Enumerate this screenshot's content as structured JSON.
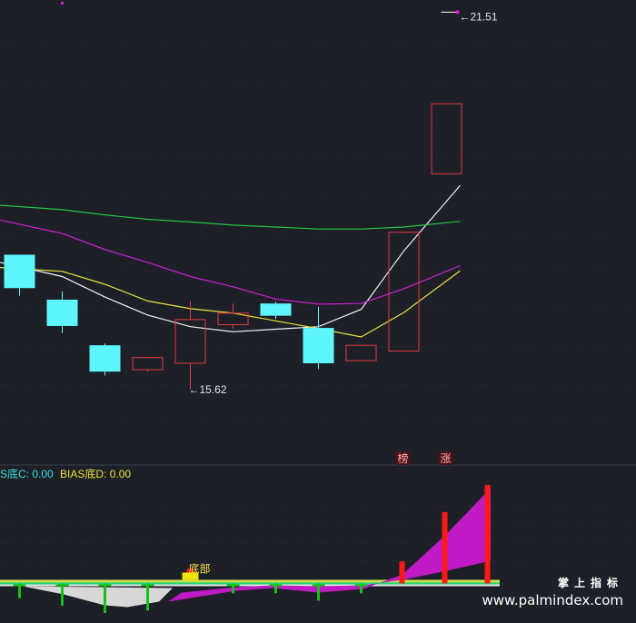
{
  "colors": {
    "bg": "#1c1f26",
    "grid": "#2a2f38",
    "up": "#e23b3b",
    "down": "#5ff7ff",
    "ma_white": "#f2f2f2",
    "ma_yellow": "#e8e23a",
    "ma_magenta": "#d21fd6",
    "ma_green": "#22c845",
    "bias_c": "#39e0e0",
    "bias_d": "#e8e23a",
    "fill_magenta": "#c01ac4",
    "bar_red": "#ff1a1a",
    "bar_green": "#14c214",
    "fill_gray": "#d8d8d8"
  },
  "chart_data": {
    "type": "candlestick",
    "price_axis": {
      "min": 14.8,
      "max": 21.6
    },
    "candles": [
      {
        "o": 17.72,
        "h": 17.72,
        "l": 17.08,
        "c": 17.2
      },
      {
        "o": 17.02,
        "h": 17.15,
        "l": 16.5,
        "c": 16.61
      },
      {
        "o": 16.31,
        "h": 16.34,
        "l": 15.84,
        "c": 15.9
      },
      {
        "o": 15.93,
        "h": 16.12,
        "l": 15.9,
        "c": 16.12
      },
      {
        "o": 16.03,
        "h": 17.0,
        "l": 15.62,
        "c": 16.71
      },
      {
        "o": 16.63,
        "h": 16.96,
        "l": 16.57,
        "c": 16.81
      },
      {
        "o": 16.96,
        "h": 16.99,
        "l": 16.72,
        "c": 16.77
      },
      {
        "o": 16.58,
        "h": 16.91,
        "l": 15.94,
        "c": 16.03
      },
      {
        "o": 16.07,
        "h": 16.31,
        "l": 16.07,
        "c": 16.31
      },
      {
        "o": 16.22,
        "h": 18.07,
        "l": 16.22,
        "c": 18.07
      },
      {
        "o": 18.98,
        "h": 20.07,
        "l": 18.98,
        "c": 20.07
      }
    ],
    "ma_lines": [
      {
        "color_key": "ma_white",
        "values": [
          17.6,
          17.38,
          17.06,
          16.78,
          16.6,
          16.52,
          16.56,
          16.6,
          16.87,
          17.78,
          18.8
        ]
      },
      {
        "color_key": "ma_yellow",
        "values": [
          17.52,
          17.46,
          17.26,
          17.0,
          16.88,
          16.81,
          16.69,
          16.57,
          16.44,
          16.82,
          17.47
        ]
      },
      {
        "color_key": "ma_magenta",
        "values": [
          18.26,
          18.05,
          17.8,
          17.6,
          17.38,
          17.22,
          17.03,
          16.95,
          16.96,
          17.19,
          17.55
        ]
      },
      {
        "color_key": "ma_green",
        "values": [
          18.49,
          18.42,
          18.34,
          18.27,
          18.23,
          18.18,
          18.15,
          18.12,
          18.12,
          18.15,
          18.24
        ]
      }
    ],
    "annotations": [
      {
        "label": "15.62",
        "candle": 4,
        "price": 15.62,
        "kind": "low"
      },
      {
        "label": "21.51",
        "candle": 10,
        "price": 21.51,
        "kind": "high"
      }
    ],
    "tags": [
      {
        "label": "榜",
        "candle": 9
      },
      {
        "label": "涨",
        "candle": 10
      }
    ],
    "indicator": {
      "legend": [
        {
          "label": "S底C: 0.00",
          "color_key": "bias_c"
        },
        {
          "label": "BIAS底D: 0.00",
          "color_key": "bias_d"
        }
      ],
      "range": {
        "min": -1.2,
        "max": 4.0
      },
      "bottom_marker": {
        "label": "底部",
        "candle": 4
      },
      "red_bars": [
        {
          "candle": 9,
          "value": 0.9
        },
        {
          "candle": 10,
          "value": 2.9
        },
        {
          "candle": 11,
          "value": 4.0
        }
      ],
      "green_bars": [
        {
          "candle": 0,
          "value": -0.6
        },
        {
          "candle": 1,
          "value": -0.9
        },
        {
          "candle": 2,
          "value": -1.2
        },
        {
          "candle": 3,
          "value": -1.1
        },
        {
          "candle": 5,
          "value": -0.4
        },
        {
          "candle": 6,
          "value": -0.4
        },
        {
          "candle": 7,
          "value": -0.7
        },
        {
          "candle": 8,
          "value": -0.4
        }
      ]
    }
  },
  "watermark": {
    "title": "掌上指标",
    "url": "www.palmindex.com"
  }
}
